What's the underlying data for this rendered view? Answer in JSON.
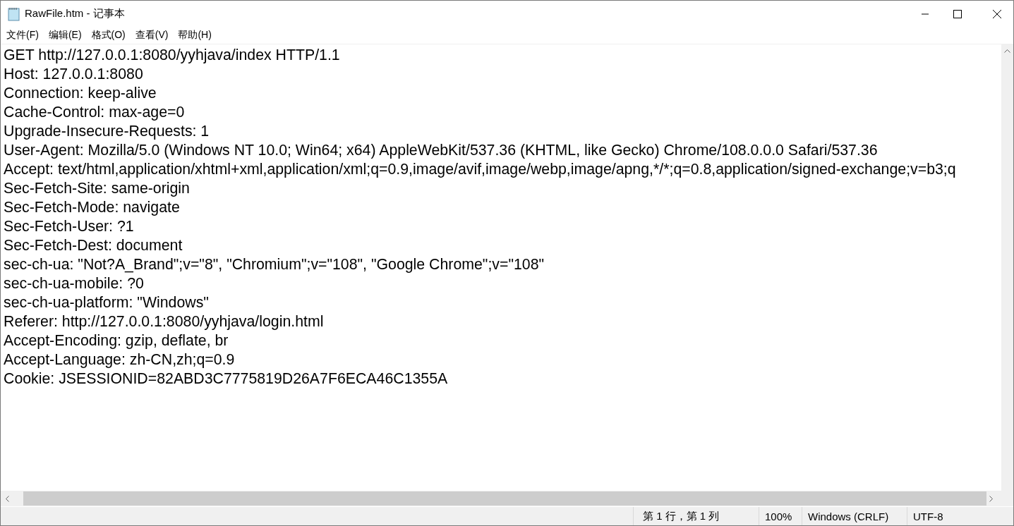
{
  "window": {
    "title": "RawFile.htm - 记事本"
  },
  "menu": [
    "文件(F)",
    "编辑(E)",
    "格式(O)",
    "查看(V)",
    "帮助(H)"
  ],
  "document": {
    "lines": [
      "GET http://127.0.0.1:8080/yyhjava/index HTTP/1.1",
      "Host: 127.0.0.1:8080",
      "Connection: keep-alive",
      "Cache-Control: max-age=0",
      "Upgrade-Insecure-Requests: 1",
      "User-Agent: Mozilla/5.0 (Windows NT 10.0; Win64; x64) AppleWebKit/537.36 (KHTML, like Gecko) Chrome/108.0.0.0 Safari/537.36",
      "Accept: text/html,application/xhtml+xml,application/xml;q=0.9,image/avif,image/webp,image/apng,*/*;q=0.8,application/signed-exchange;v=b3;q",
      "Sec-Fetch-Site: same-origin",
      "Sec-Fetch-Mode: navigate",
      "Sec-Fetch-User: ?1",
      "Sec-Fetch-Dest: document",
      "sec-ch-ua: \"Not?A_Brand\";v=\"8\", \"Chromium\";v=\"108\", \"Google Chrome\";v=\"108\"",
      "sec-ch-ua-mobile: ?0",
      "sec-ch-ua-platform: \"Windows\"",
      "Referer: http://127.0.0.1:8080/yyhjava/login.html",
      "Accept-Encoding: gzip, deflate, br",
      "Accept-Language: zh-CN,zh;q=0.9",
      "Cookie: JSESSIONID=82ABD3C7775819D26A7F6ECA46C1355A"
    ]
  },
  "status_bar": {
    "position": "第 1 行，第 1 列",
    "zoom": "100%",
    "line_ending": "Windows (CRLF)",
    "encoding": "UTF-8"
  }
}
